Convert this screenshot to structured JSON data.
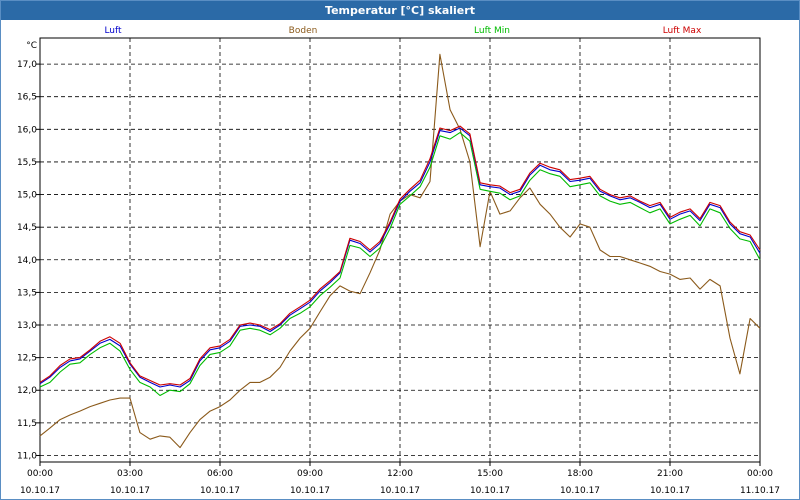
{
  "chart_data": {
    "type": "line",
    "title": "Temperatur [°C] skaliert",
    "ylabel": "°C",
    "xlabel": "",
    "ylim": [
      10.9,
      17.4
    ],
    "xlim": [
      0,
      24
    ],
    "grid": true,
    "legend_position": "top",
    "yticks": [
      "11,0",
      "11,5",
      "12,0",
      "12,5",
      "13,0",
      "13,5",
      "14,0",
      "14,5",
      "15,0",
      "15,5",
      "16,0",
      "16,5",
      "17,0"
    ],
    "yticks_values": [
      11.0,
      11.5,
      12.0,
      12.5,
      13.0,
      13.5,
      14.0,
      14.5,
      15.0,
      15.5,
      16.0,
      16.5,
      17.0
    ],
    "xticks_values": [
      0,
      3,
      6,
      9,
      12,
      15,
      18,
      21,
      24
    ],
    "xticks_time": [
      "00:00",
      "03:00",
      "06:00",
      "09:00",
      "12:00",
      "15:00",
      "18:00",
      "21:00",
      "00:00"
    ],
    "xticks_date": [
      "10.10.17",
      "10.10.17",
      "10.10.17",
      "10.10.17",
      "10.10.17",
      "10.10.17",
      "10.10.17",
      "10.10.17",
      "11.10.17"
    ],
    "x": [
      0,
      0.33,
      0.67,
      1,
      1.33,
      1.67,
      2,
      2.33,
      2.67,
      3,
      3.33,
      3.67,
      4,
      4.33,
      4.67,
      5,
      5.33,
      5.67,
      6,
      6.33,
      6.67,
      7,
      7.33,
      7.67,
      8,
      8.33,
      8.67,
      9,
      9.33,
      9.67,
      10,
      10.33,
      10.67,
      11,
      11.33,
      11.67,
      12,
      12.33,
      12.67,
      13,
      13.33,
      13.67,
      14,
      14.33,
      14.67,
      15,
      15.33,
      15.67,
      16,
      16.33,
      16.67,
      17,
      17.33,
      17.67,
      18,
      18.33,
      18.67,
      19,
      19.33,
      19.67,
      20,
      20.33,
      20.67,
      21,
      21.33,
      21.67,
      22,
      22.33,
      22.67,
      23,
      23.33,
      23.67,
      24
    ],
    "series": [
      {
        "name": "Luft",
        "color": "#0000cc",
        "values": [
          12.1,
          12.2,
          12.35,
          12.45,
          12.48,
          12.6,
          12.72,
          12.78,
          12.68,
          12.4,
          12.2,
          12.12,
          12.05,
          12.08,
          12.05,
          12.15,
          12.45,
          12.62,
          12.65,
          12.75,
          12.98,
          13.0,
          12.98,
          12.9,
          13.0,
          13.15,
          13.25,
          13.35,
          13.52,
          13.65,
          13.8,
          14.3,
          14.25,
          14.12,
          14.25,
          14.55,
          14.9,
          15.05,
          15.18,
          15.5,
          15.98,
          15.95,
          16.02,
          15.9,
          15.15,
          15.12,
          15.1,
          15.0,
          15.05,
          15.3,
          15.45,
          15.38,
          15.35,
          15.2,
          15.22,
          15.25,
          15.05,
          14.98,
          14.92,
          14.95,
          14.88,
          14.8,
          14.85,
          14.62,
          14.7,
          14.75,
          14.6,
          14.85,
          14.8,
          14.55,
          14.4,
          14.35,
          14.1
        ]
      },
      {
        "name": "Boden",
        "color": "#8b5a1b",
        "values": [
          11.3,
          11.42,
          11.55,
          11.62,
          11.68,
          11.75,
          11.8,
          11.85,
          11.88,
          11.88,
          11.35,
          11.25,
          11.3,
          11.28,
          11.12,
          11.35,
          11.55,
          11.68,
          11.75,
          11.85,
          12.0,
          12.12,
          12.12,
          12.2,
          12.35,
          12.6,
          12.8,
          12.95,
          13.2,
          13.45,
          13.6,
          13.52,
          13.48,
          13.8,
          14.15,
          14.7,
          14.9,
          15.0,
          14.95,
          15.2,
          17.15,
          16.3,
          16.0,
          15.5,
          14.2,
          15.05,
          14.7,
          14.75,
          14.95,
          15.1,
          14.85,
          14.7,
          14.5,
          14.35,
          14.55,
          14.5,
          14.15,
          14.05,
          14.05,
          14.0,
          13.95,
          13.9,
          13.82,
          13.78,
          13.7,
          13.72,
          13.55,
          13.7,
          13.6,
          12.8,
          12.25,
          13.1,
          12.95
        ]
      },
      {
        "name": "Luft Min",
        "color": "#00bb00",
        "values": [
          12.05,
          12.12,
          12.28,
          12.4,
          12.42,
          12.55,
          12.65,
          12.72,
          12.6,
          12.32,
          12.12,
          12.05,
          11.92,
          12.0,
          11.98,
          12.1,
          12.38,
          12.55,
          12.58,
          12.68,
          12.92,
          12.95,
          12.92,
          12.85,
          12.95,
          13.1,
          13.18,
          13.28,
          13.45,
          13.58,
          13.72,
          14.22,
          14.18,
          14.05,
          14.18,
          14.48,
          14.85,
          14.98,
          15.12,
          15.42,
          15.9,
          15.85,
          15.95,
          15.82,
          15.08,
          15.05,
          15.02,
          14.92,
          14.98,
          15.22,
          15.38,
          15.32,
          15.28,
          15.12,
          15.15,
          15.18,
          14.98,
          14.9,
          14.85,
          14.88,
          14.8,
          14.72,
          14.78,
          14.55,
          14.62,
          14.68,
          14.52,
          14.78,
          14.72,
          14.48,
          14.32,
          14.28,
          14.0
        ]
      },
      {
        "name": "Luft Max",
        "color": "#cc0000",
        "values": [
          12.12,
          12.22,
          12.38,
          12.48,
          12.5,
          12.62,
          12.75,
          12.82,
          12.72,
          12.42,
          12.22,
          12.15,
          12.08,
          12.1,
          12.08,
          12.18,
          12.48,
          12.65,
          12.68,
          12.78,
          13.0,
          13.03,
          13.0,
          12.93,
          13.02,
          13.18,
          13.28,
          13.38,
          13.55,
          13.68,
          13.82,
          14.33,
          14.28,
          14.15,
          14.28,
          14.58,
          14.93,
          15.08,
          15.22,
          15.55,
          16.02,
          15.98,
          16.05,
          15.93,
          15.18,
          15.15,
          15.13,
          15.03,
          15.08,
          15.33,
          15.48,
          15.42,
          15.38,
          15.23,
          15.25,
          15.28,
          15.08,
          15.0,
          14.95,
          14.98,
          14.9,
          14.83,
          14.88,
          14.65,
          14.73,
          14.78,
          14.63,
          14.88,
          14.83,
          14.58,
          14.43,
          14.38,
          14.15
        ]
      }
    ]
  }
}
